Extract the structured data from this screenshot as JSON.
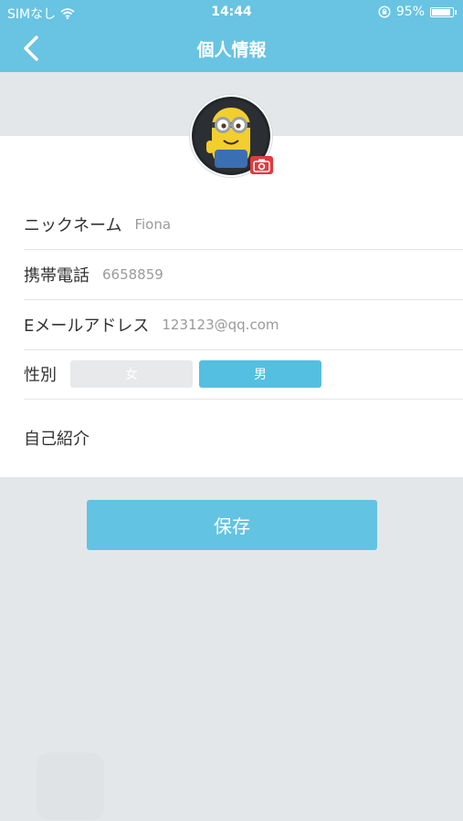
{
  "status_bar": {
    "carrier": "SIMなし",
    "time": "14:44",
    "battery": "95%",
    "battery_level": 0.95
  },
  "header": {
    "title": "個人情報",
    "back_icon": "chevron-left-icon"
  },
  "profile": {
    "avatar_icon": "minion-avatar",
    "camera_icon": "camera-icon"
  },
  "fields": {
    "nickname": {
      "label": "ニックネーム",
      "value": "Fiona"
    },
    "phone": {
      "label": "携帯電話",
      "value": "6658859"
    },
    "email": {
      "label": "Eメールアドレス",
      "value": "123123@qq.com"
    },
    "gender": {
      "label": "性別",
      "options": [
        "女",
        "男"
      ],
      "selected": "男"
    },
    "bio": {
      "label": "自己紹介"
    }
  },
  "actions": {
    "save_label": "保存"
  },
  "colors": {
    "header_bg": "#68c4e2",
    "accent": "#55bfe2",
    "page_bg": "#e3e7ea",
    "badge_red": "#e4393c"
  }
}
